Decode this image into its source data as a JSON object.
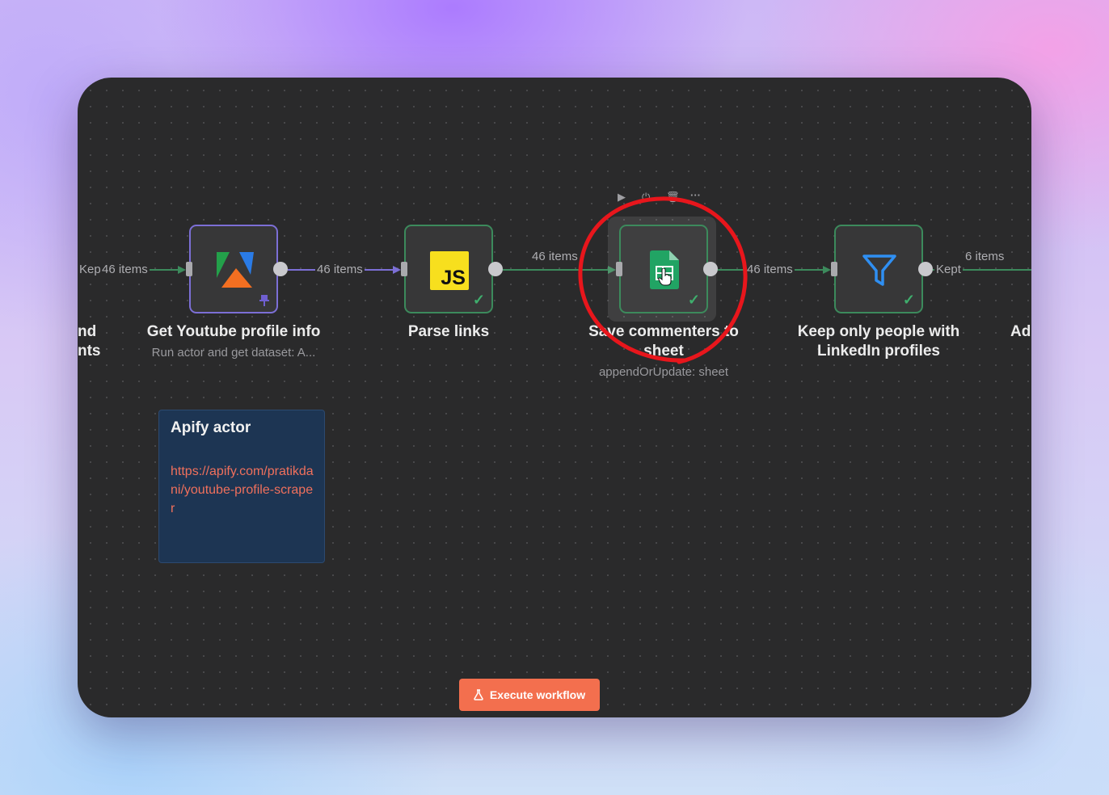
{
  "edges": {
    "in_kept": "Kept",
    "in_items": "46 items",
    "e1": "46 items",
    "e2": "46 items",
    "e3": "46 items",
    "e4_count": "6 items",
    "e4_branch": "Kept"
  },
  "nodes": {
    "partial_left": {
      "line1": "nd",
      "line2": "nts"
    },
    "youtube": {
      "title": "Get Youtube profile info",
      "subtitle": "Run actor and get dataset: A..."
    },
    "parse": {
      "title": "Parse links",
      "icon_text": "JS"
    },
    "sheet": {
      "title_line1": "Save commenters to",
      "title_line2": "sheet",
      "subtitle": "appendOrUpdate: sheet"
    },
    "filter": {
      "title_line1": "Keep only people with",
      "title_line2": "LinkedIn profiles"
    },
    "partial_right": {
      "title": "Ad"
    }
  },
  "sticky": {
    "title": "Apify actor",
    "link": "https://apify.com/pratikdani/youtube-profile-scraper"
  },
  "execute_button": {
    "label": "Execute workflow"
  },
  "node_toolbar": {
    "icons": [
      "play-icon",
      "power-icon",
      "trash-icon",
      "more-icon"
    ]
  },
  "colors": {
    "canvas": "#2a2a2b",
    "success_edge": "#3c8a5c",
    "apify_edge": "#7c6fd6",
    "accent": "#f36f4e",
    "highlight_circle": "#e8161c",
    "sticky_bg": "#1d3553",
    "link": "#f0705c"
  }
}
